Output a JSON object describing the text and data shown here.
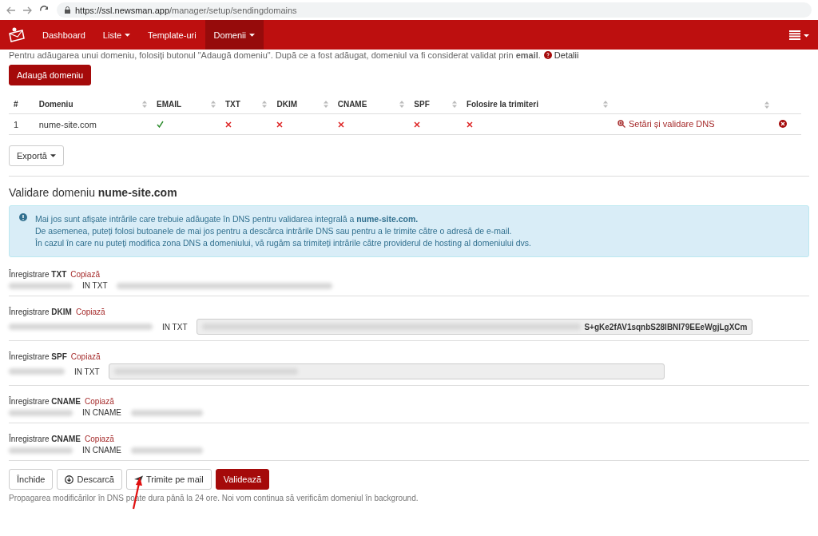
{
  "browser": {
    "url_host": "https://ssl.newsman.app",
    "url_path": "/manager/setup/sendingdomains"
  },
  "nav": {
    "items": [
      {
        "label": "Dashboard",
        "dropdown": false,
        "selected": false
      },
      {
        "label": "Liste",
        "dropdown": true,
        "selected": false
      },
      {
        "label": "Template-uri",
        "dropdown": false,
        "selected": false
      },
      {
        "label": "Domenii",
        "dropdown": true,
        "selected": true
      }
    ]
  },
  "intro": {
    "text": "Pentru adăugarea unui domeniu, folosiți butonul \"Adaugă domeniu\". După ce a fost adăugat, domeniul va fi considerat validat prin **email**.",
    "link": "Detalii"
  },
  "add_button": "Adaugă domeniu",
  "table": {
    "columns": [
      "#",
      "Domeniu",
      "EMAIL",
      "TXT",
      "DKIM",
      "CNAME",
      "SPF",
      "Folosire la trimiteri"
    ],
    "rows": [
      {
        "number": "1",
        "domain": "nume-site.com",
        "checks": [
          true,
          false,
          false,
          false,
          false,
          false
        ],
        "action": "Setări și validare DNS"
      }
    ]
  },
  "export_button": "Exportă",
  "validation": {
    "title": "Validare domeniu **nume-site.com**",
    "info": [
      "Mai jos sunt afișate intrările care trebuie adăugate în DNS pentru validarea integrală a **nume-site.com.**",
      "De asemenea, puteți folosi butoanele de mai jos pentru a descărca intrările DNS sau pentru a le trimite către o adresă de e-mail.",
      "În cazul în care nu puteți modifica zona DNS a domeniului, vă rugăm sa trimiteți intrările către providerul de hosting al domeniului dvs."
    ],
    "records": [
      {
        "prefix": "Înregistrare",
        "type": "TXT",
        "copy": "Copiază",
        "record_class": "IN TXT",
        "kind": "plain"
      },
      {
        "prefix": "Înregistrare",
        "type": "DKIM",
        "copy": "Copiază",
        "record_class": "IN TXT",
        "kind": "field",
        "value_tail": "S+gKe2fAV1sqnbS28IBNI79EEeWgjLgXCm"
      },
      {
        "prefix": "Înregistrare",
        "type": "SPF",
        "copy": "Copiază",
        "record_class": "IN TXT",
        "kind": "field"
      },
      {
        "prefix": "Înregistrare",
        "type": "CNAME",
        "copy": "Copiază",
        "record_class": "IN CNAME",
        "kind": "plain"
      },
      {
        "prefix": "Înregistrare",
        "type": "CNAME",
        "copy": "Copiază",
        "record_class": "IN CNAME",
        "kind": "plain"
      }
    ],
    "buttons": [
      {
        "label": "Închide",
        "kind": "plain"
      },
      {
        "label": "Descarcă",
        "kind": "download"
      },
      {
        "label": "Trimite pe mail",
        "kind": "send"
      },
      {
        "label": "Validează",
        "kind": "primary"
      }
    ],
    "note": "Propagarea modificărilor în DNS poate dura până la 24 ore. Noi vom continua să verificăm domeniul în background."
  }
}
